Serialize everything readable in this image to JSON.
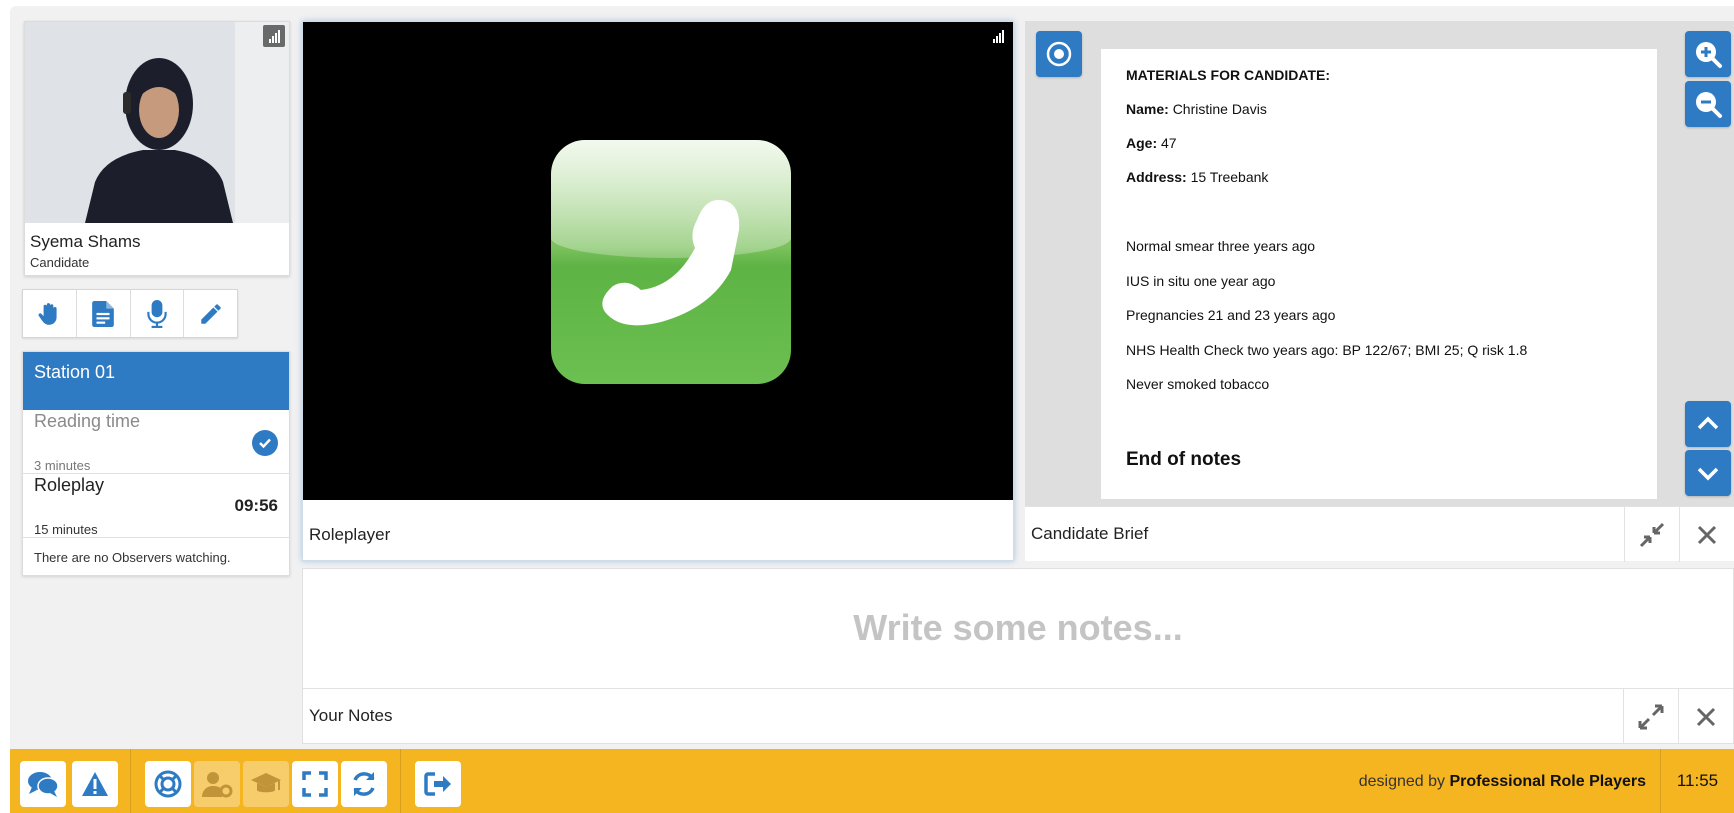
{
  "candidate": {
    "name": "Syema Shams",
    "role": "Candidate"
  },
  "tools": [
    {
      "name": "raise-hand",
      "icon": "hand-icon"
    },
    {
      "name": "document",
      "icon": "document-icon"
    },
    {
      "name": "microphone",
      "icon": "microphone-icon"
    },
    {
      "name": "pencil",
      "icon": "pencil-icon"
    }
  ],
  "station": {
    "title": "Station 01",
    "steps": [
      {
        "title": "Reading time",
        "duration": "3 minutes",
        "done": true
      },
      {
        "title": "Roleplay",
        "duration": "15 minutes",
        "timer": "09:56"
      }
    ],
    "observers": "There are no Observers watching."
  },
  "roleplayer": {
    "label": "Roleplayer"
  },
  "brief": {
    "label": "Candidate Brief",
    "heading": "MATERIALS FOR CANDIDATE:",
    "name_key": "Name:",
    "name_val": "Christine Davis",
    "age_key": "Age:",
    "age_val": "47",
    "address_key": "Address:",
    "address_val": "15 Treebank",
    "lines": [
      "Normal smear three years ago",
      "IUS in situ one year ago",
      "Pregnancies 21 and 23 years ago",
      "NHS Health Check two years ago: BP 122/67; BMI 25; Q risk 1.8",
      "Never smoked tobacco"
    ],
    "end": "End of notes"
  },
  "notes": {
    "placeholder": "Write some notes...",
    "label": "Your Notes"
  },
  "footer": {
    "credit_prefix": "designed by",
    "credit_brand": "Professional Role Players",
    "time": "11:55"
  },
  "colors": {
    "accent": "#2e7bc4",
    "bar": "#f5b521"
  }
}
